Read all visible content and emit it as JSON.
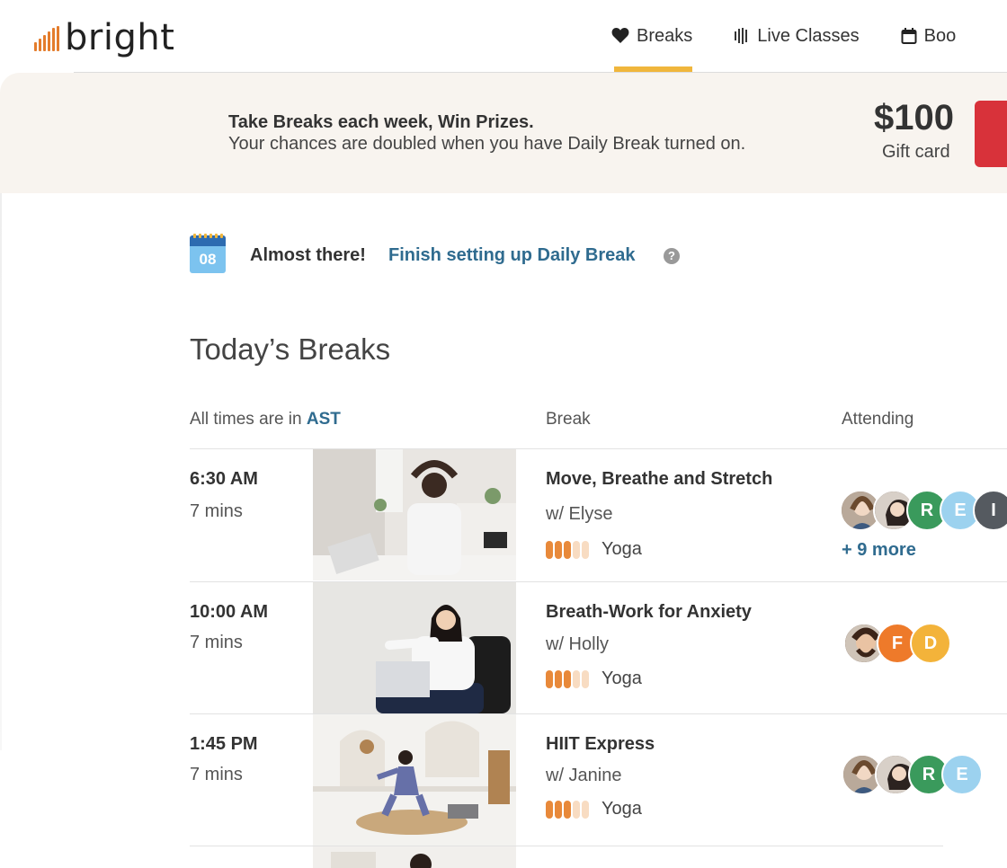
{
  "header": {
    "logo_text": "bright",
    "nav": [
      {
        "label": "Breaks",
        "icon": "heart-icon",
        "active": true
      },
      {
        "label": "Live Classes",
        "icon": "live-bars-icon",
        "active": false
      },
      {
        "label": "Boo",
        "icon": "calendar-icon",
        "active": false
      }
    ]
  },
  "banner": {
    "title": "Take Breaks each week, Win Prizes.",
    "subtitle": "Your chances are doubled when you have Daily Break turned on.",
    "prize_amount": "$100",
    "prize_label": "Gift card"
  },
  "setup": {
    "calendar_day": "08",
    "status": "Almost there!",
    "link": "Finish setting up Daily Break",
    "help": "?"
  },
  "section": {
    "title": "Today’s Breaks",
    "col_times_prefix": "All times are in ",
    "timezone": "AST",
    "col_break": "Break",
    "col_attending": "Attending"
  },
  "breaks": [
    {
      "time": "6:30 AM",
      "duration": "7 mins",
      "title": "Move, Breathe and Stretch",
      "instructor": "w/ Elyse",
      "category": "Yoga",
      "intensity": 3,
      "attendees": [
        {
          "type": "photo",
          "color": "#8a6f5a"
        },
        {
          "type": "photo",
          "color": "#6b5a4d"
        },
        {
          "type": "initial",
          "initial": "R",
          "color": "#3a9a5c"
        },
        {
          "type": "initial",
          "initial": "E",
          "color": "#9cd2ef"
        },
        {
          "type": "initial",
          "initial": "I",
          "color": "#555a60"
        }
      ],
      "more": "+ 9 more"
    },
    {
      "time": "10:00 AM",
      "duration": "7 mins",
      "title": "Breath-Work for Anxiety",
      "instructor": "w/ Holly",
      "category": "Yoga",
      "intensity": 3,
      "attendees": [
        {
          "type": "photo",
          "color": "#5a3e2e"
        },
        {
          "type": "initial",
          "initial": "F",
          "color": "#ee7a2a"
        },
        {
          "type": "initial",
          "initial": "D",
          "color": "#f3b33a"
        }
      ],
      "more": ""
    },
    {
      "time": "1:45 PM",
      "duration": "7 mins",
      "title": "HIIT Express",
      "instructor": "w/ Janine",
      "category": "Yoga",
      "intensity": 3,
      "attendees": [
        {
          "type": "photo",
          "color": "#8a6f5a"
        },
        {
          "type": "photo",
          "color": "#6b5a4d"
        },
        {
          "type": "initial",
          "initial": "R",
          "color": "#3a9a5c"
        },
        {
          "type": "initial",
          "initial": "E",
          "color": "#9cd2ef"
        }
      ],
      "more": ""
    }
  ]
}
